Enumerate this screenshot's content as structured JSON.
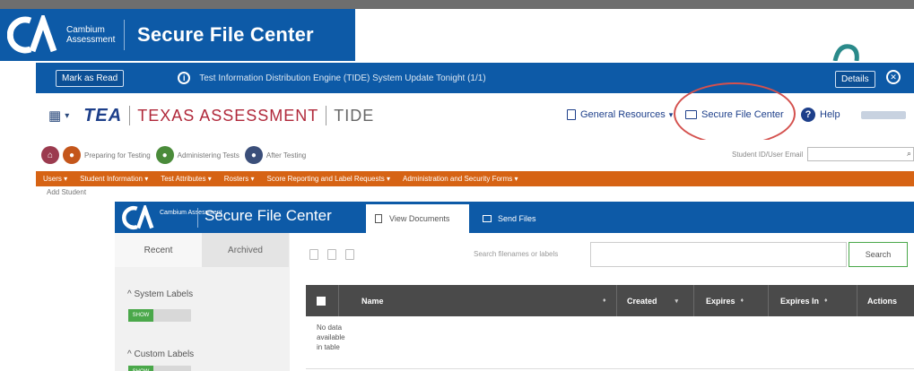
{
  "outer": {
    "brand": "Cambium Assessment",
    "title": "Secure File Center"
  },
  "notice": {
    "mark_read": "Mark as Read",
    "message": "Test Information Distribution Engine (TIDE) System Update Tonight (1/1)",
    "details": "Details"
  },
  "tea_header": {
    "tea": "TEA",
    "texas": "TEXAS ASSESSMENT",
    "tide": "TIDE",
    "general_resources": "General Resources",
    "secure_file_center": "Secure File Center",
    "help": "Help"
  },
  "steps": {
    "preparing": "Preparing for Testing",
    "administering": "Administering Tests",
    "after": "After Testing",
    "student_search_label": "Student ID/User Email"
  },
  "orange_nav": [
    "Users",
    "Student Information",
    "Test Attributes",
    "Rosters",
    "Score Reporting and Label Requests",
    "Administration and Security Forms"
  ],
  "sub_item": "Add Student",
  "inner": {
    "brand": "Cambium Assessment",
    "title": "Secure File Center",
    "tab_view": "View Documents",
    "tab_send": "Send Files"
  },
  "sidebar": {
    "tab_recent": "Recent",
    "tab_archived": "Archived",
    "system_labels": "System Labels",
    "custom_labels": "Custom Labels",
    "show": "SHOW"
  },
  "content": {
    "search_placeholder": "Search filenames or labels",
    "search_button": "Search",
    "columns": {
      "name": "Name",
      "created": "Created",
      "expires": "Expires",
      "expires_in": "Expires In",
      "actions": "Actions"
    },
    "no_data": "No data available in table"
  },
  "colors": {
    "brand_blue": "#0d5aa7",
    "tea_orange": "#d66314",
    "highlight_red": "#d4514e",
    "show_green": "#4aa84a"
  }
}
